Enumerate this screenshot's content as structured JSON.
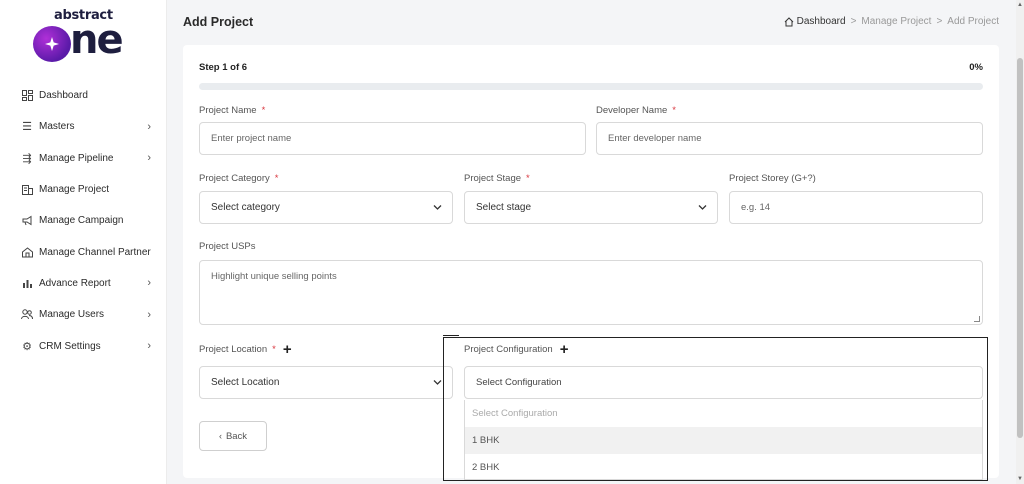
{
  "logo": {
    "top_text": "abstract",
    "main_text": "one"
  },
  "sidebar": {
    "items": [
      {
        "label": "Dashboard",
        "icon": "dashboard-icon",
        "has_submenu": false
      },
      {
        "label": "Masters",
        "icon": "list-icon",
        "has_submenu": true
      },
      {
        "label": "Manage Pipeline",
        "icon": "pipeline-icon",
        "has_submenu": true
      },
      {
        "label": "Manage Project",
        "icon": "building-icon",
        "has_submenu": false
      },
      {
        "label": "Manage Campaign",
        "icon": "megaphone-icon",
        "has_submenu": false
      },
      {
        "label": "Manage Channel Partner",
        "icon": "handshake-icon",
        "has_submenu": false
      },
      {
        "label": "Advance Report",
        "icon": "bar-chart-icon",
        "has_submenu": true
      },
      {
        "label": "Manage Users",
        "icon": "users-icon",
        "has_submenu": true
      },
      {
        "label": "CRM Settings",
        "icon": "gear-icon",
        "has_submenu": true
      }
    ]
  },
  "header": {
    "title": "Add Project",
    "breadcrumb": [
      "Dashboard",
      "Manage Project",
      "Add Project"
    ]
  },
  "form": {
    "step_text": "Step 1 of 6",
    "progress_text": "0%",
    "progress_fraction": 0,
    "project_name": {
      "label": "Project Name",
      "required": "*",
      "placeholder": "Enter project name"
    },
    "developer_name": {
      "label": "Developer Name",
      "required": "*",
      "placeholder": "Enter developer name"
    },
    "project_category": {
      "label": "Project Category",
      "required": "*",
      "value": "Select category"
    },
    "project_stage": {
      "label": "Project Stage",
      "required": "*",
      "value": "Select stage"
    },
    "project_storey": {
      "label": "Project Storey (G+?)",
      "placeholder": "e.g. 14"
    },
    "project_usps": {
      "label": "Project USPs",
      "placeholder": "Highlight unique selling points"
    },
    "project_location": {
      "label": "Project Location",
      "required": "*",
      "value": "Select Location"
    },
    "project_configuration": {
      "label": "Project Configuration",
      "value": "Select Configuration",
      "options": [
        "Select Configuration",
        "1 BHK",
        "2 BHK"
      ]
    },
    "back_button": "Back"
  },
  "colors": {
    "accent": "#5a2ba8",
    "required": "#d9363e"
  }
}
